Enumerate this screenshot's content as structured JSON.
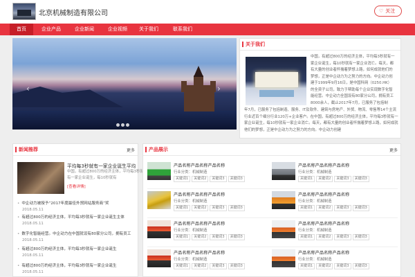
{
  "header": {
    "company_name": "北京机械制造有限公司",
    "follow_label": "关注",
    "follow_icon": "heart-icon"
  },
  "nav": {
    "items": [
      "首页",
      "企业产品",
      "企业新闻",
      "企业视频",
      "关于我们",
      "联系我们"
    ],
    "active_index": 0
  },
  "about": {
    "title": "关于我们",
    "text_top": "中国，有超过800万的经济主体，平均每3秒就有一家企业诞生，每10秒就有一家企业消亡。每天，都有大量的创业者怀揣着梦想上路，如何成就他们的梦想，正是中企动力为之努力的方向。中企动力创建于1999年9月16日，是中国科网（0250.HK）的全资子公司，致力于帮助每个企业实现数字化智能经营。中企动力全国设有80家分公司，拥有员工8000余人，截止2017年7月，已服务了包括制造、服务、IT及软件、建筑与房地产、外贸、物流、零售等14个主流行业近百个细分行业120万+企业客户。",
    "text_bottom": "年7月，已服务了包括制造、服务、IT及软件、建筑与房地产、外贸、物流、零售等14个主流行业近百个细分行业120万+企业客户。在中国，有超过800万的经济主体，平均每3秒就有一家企业诞生，每10秒就有一家企业消亡。每天，都有大量的创业者怀揣着梦想上路，如何成就他们的梦想，正是中企动力为之努力的方向。中企动力创建"
  },
  "news": {
    "title": "新闻推荐",
    "more": "更多",
    "feature": {
      "title": "平均每3秒就有一家企业诞生平均",
      "desc": "中国，有超过800万的经济主体，平均每3秒就有一家企业诞生，每10秒就有",
      "link": "[查看详情]"
    },
    "items": [
      {
        "title": "中企动力被授予“2017年度最佳外贸网站服务商”奖",
        "date": "2018.05.11"
      },
      {
        "title": "有超过800万的经济主体，平均每3秒就有一家企业诞生主体",
        "date": "2018.05.11"
      },
      {
        "title": "数字化智能经营。中企动力在中国就设有80家分公司，拥有员工",
        "date": "2018.05.11"
      },
      {
        "title": "有超过800万的经济主体，平均每3秒就有一家企业诞生",
        "date": "2018.05.11"
      },
      {
        "title": "有超过800万的经济主体，平均每3秒就有一家企业诞生",
        "date": "2018.05.11"
      }
    ]
  },
  "products": {
    "title": "产品展示",
    "more": "更多",
    "items": [
      {
        "name": "产品名称产品名称产品名称",
        "category": "行业分类：机械制造",
        "tags": [
          "关键词1",
          "关键词2",
          "关键词3",
          "关键词3"
        ],
        "image": "green-truck-image"
      },
      {
        "name": "产品名称产品名称产品名称",
        "category": "行业分类：机械制造",
        "tags": [
          "关键词1",
          "关键词2",
          "关键词3",
          "关键词3"
        ],
        "image": "truck-image"
      },
      {
        "name": "产品名称产品名称产品名称",
        "category": "行业分类：机械制造",
        "tags": [
          "关键词1",
          "关键词2",
          "关键词3",
          "关键词3"
        ],
        "image": "crane-image"
      },
      {
        "name": "产品名称产品名称产品名称",
        "category": "行业分类：机械制造",
        "tags": [
          "关键词1",
          "关键词2",
          "关键词3",
          "关键词3"
        ],
        "image": "orange-truck-image"
      },
      {
        "name": "产品名称产品名称产品名称",
        "category": "行业分类：机械制造",
        "tags": [
          "关键词1",
          "关键词2",
          "关键词3",
          "关键词3"
        ],
        "image": "red-trailer-image"
      },
      {
        "name": "产品名称产品名称产品名称",
        "category": "行业分类：机械制造",
        "tags": [
          "关键词1",
          "关键词2",
          "关键词3",
          "关键词3"
        ],
        "image": "red-trailer-image"
      },
      {
        "name": "产品名称产品名称产品名称",
        "category": "行业分类：机械制造",
        "tags": [
          "关键词1",
          "关键词2",
          "关键词3",
          "关键词3"
        ],
        "image": "red-trailer-image"
      },
      {
        "name": "产品名称产品名称产品名称",
        "category": "行业分类：机械制造",
        "tags": [
          "关键词1",
          "关键词2",
          "关键词3",
          "关键词3"
        ],
        "image": "red-trailer-image"
      }
    ]
  },
  "colors": {
    "accent": "#e8343f",
    "nav_active": "#c61e27"
  }
}
